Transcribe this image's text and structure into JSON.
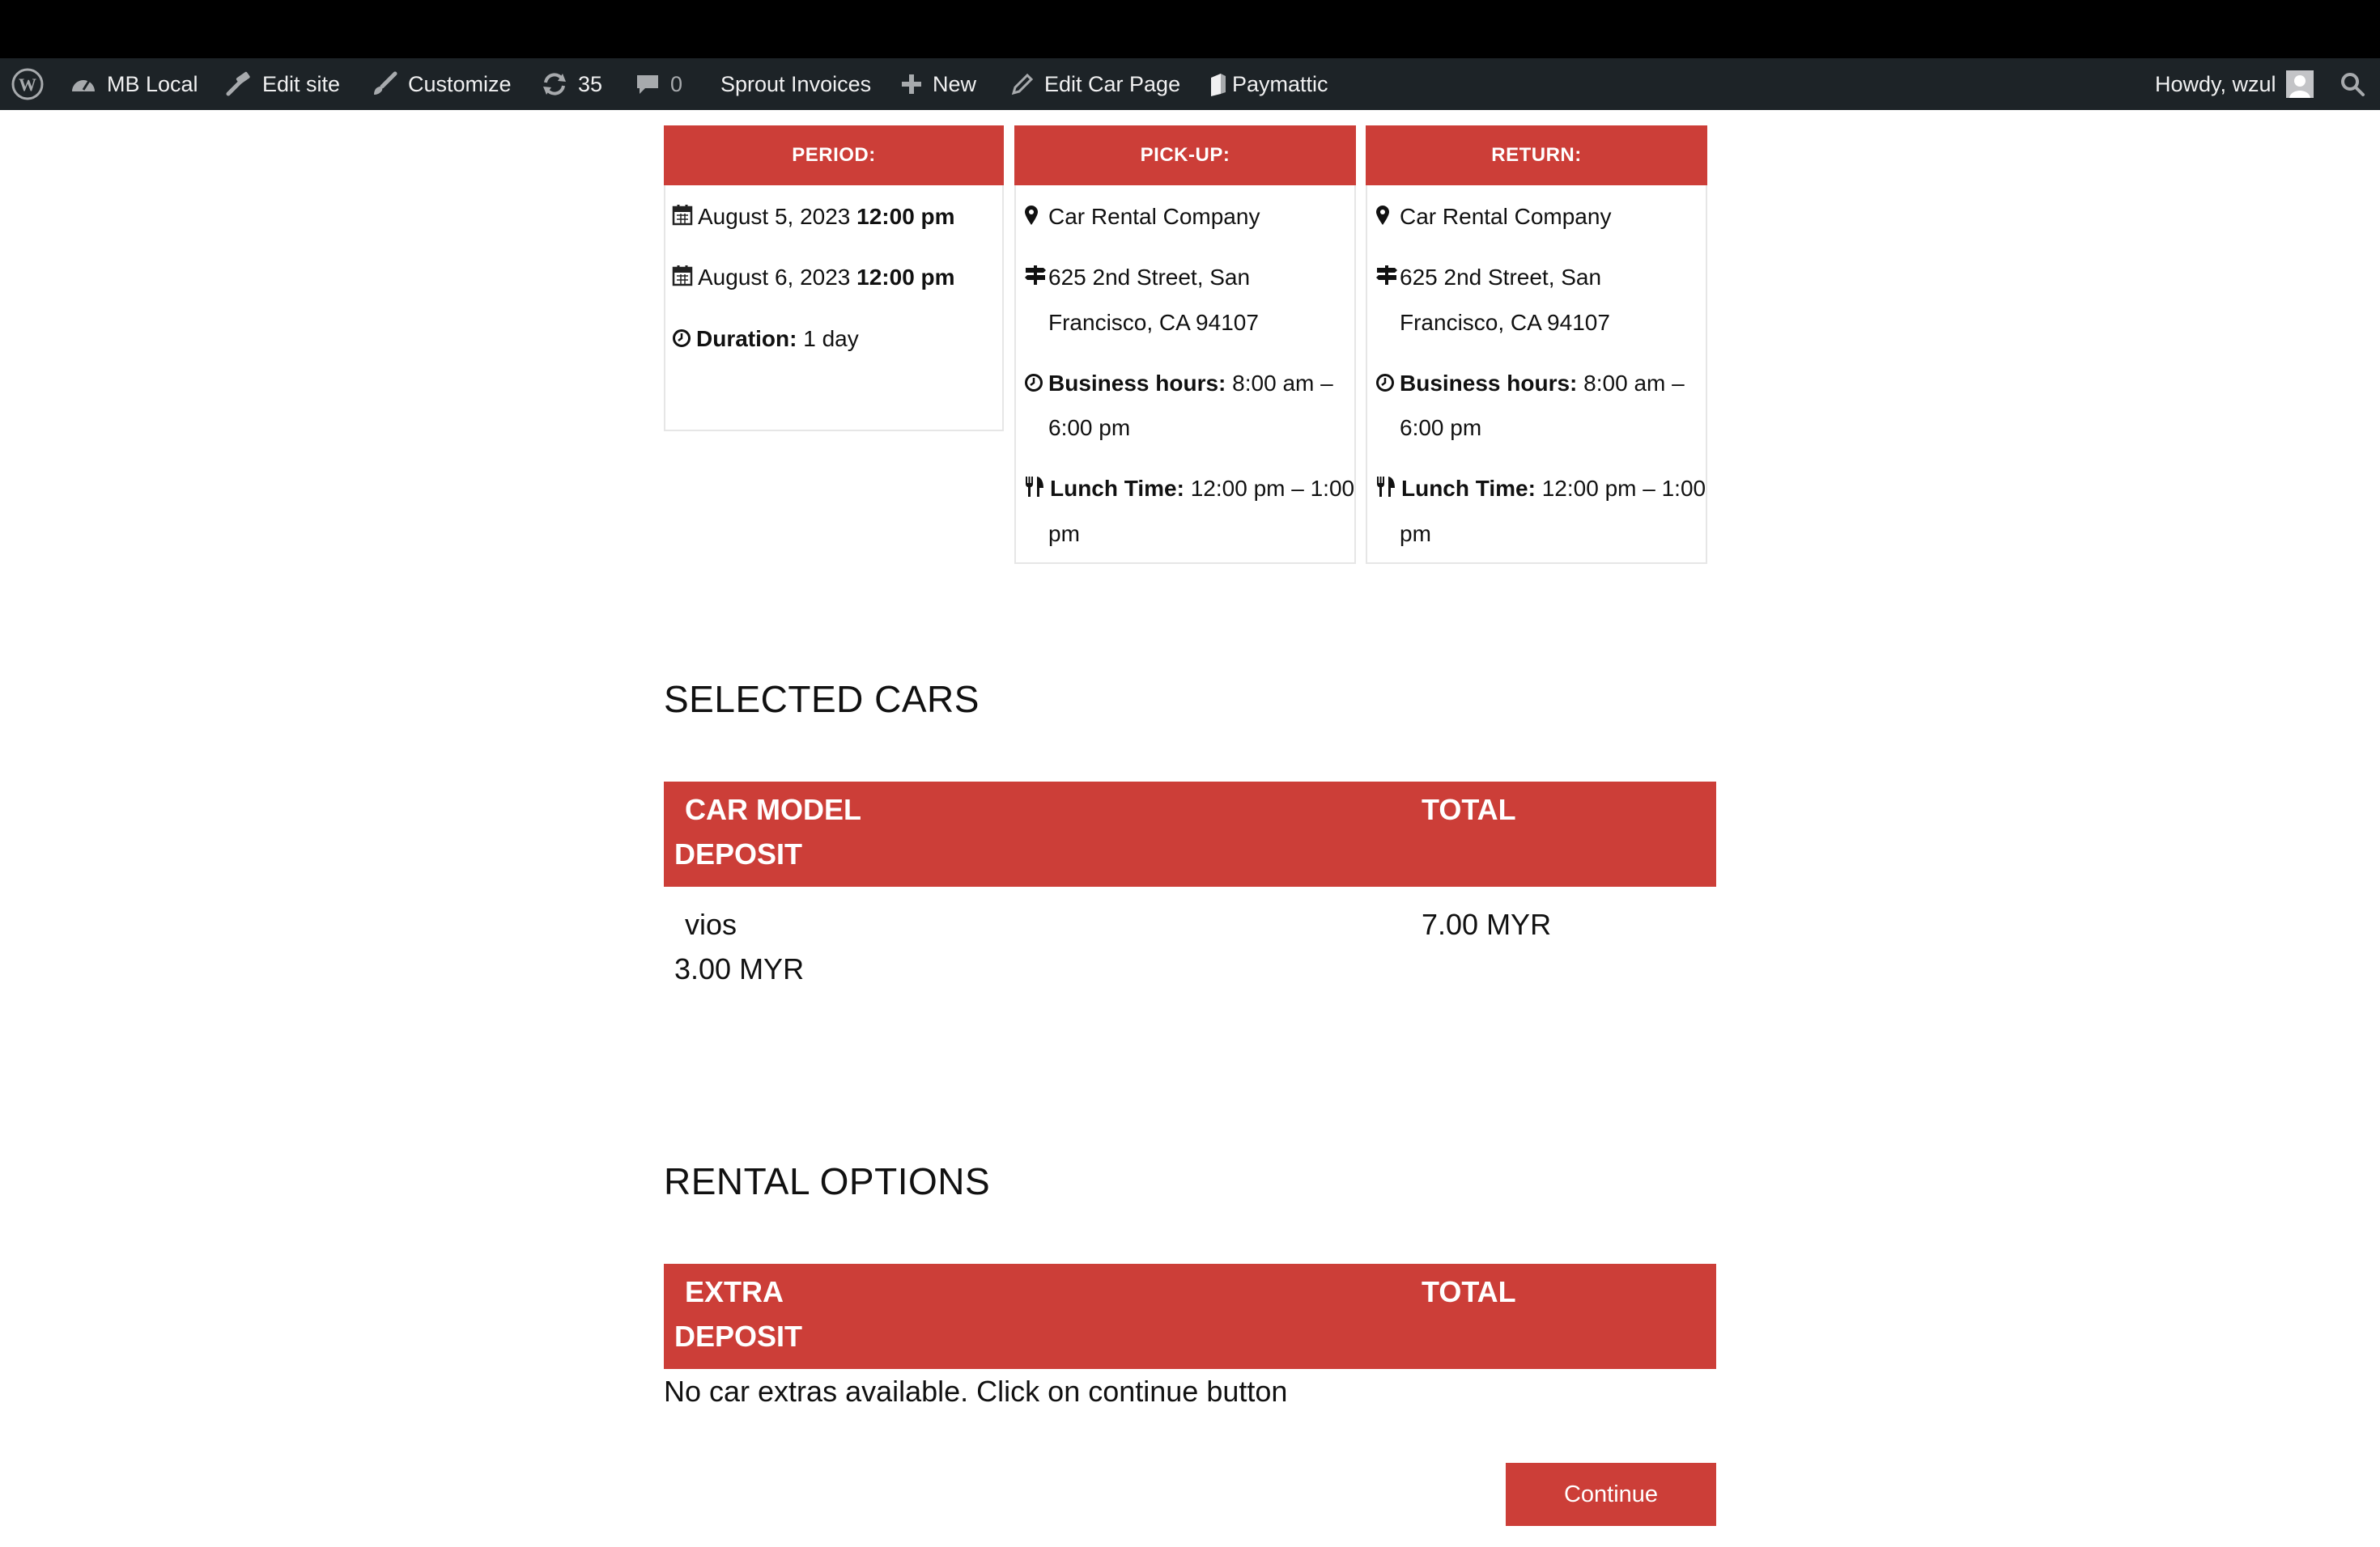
{
  "admin_bar": {
    "site_name": "MB Local",
    "edit_site": "Edit site",
    "customize": "Customize",
    "updates_count": "35",
    "comments_count": "0",
    "sprout_invoices": "Sprout Invoices",
    "new": "New",
    "edit_car_page": "Edit Car Page",
    "paymattic": "Paymattic",
    "howdy": "Howdy, wzul"
  },
  "summary": {
    "period": {
      "header": "PERIOD:",
      "start_date": "August 5, 2023",
      "start_time": "12:00 pm",
      "end_date": "August 6, 2023",
      "end_time": "12:00 pm",
      "duration_label": "Duration:",
      "duration_value": "1 day"
    },
    "pickup": {
      "header": "PICK-UP:",
      "company": "Car Rental Company",
      "address_line1": "625 2nd Street, San",
      "address_line2": "Francisco, CA 94107",
      "hours_label": "Business hours:",
      "hours_line1": "8:00 am –",
      "hours_line2": "6:00 pm",
      "lunch_label": "Lunch Time:",
      "lunch_line1": "12:00 pm – 1:00",
      "lunch_line2": "pm"
    },
    "return": {
      "header": "RETURN:",
      "company": "Car Rental Company",
      "address_line1": "625 2nd Street, San",
      "address_line2": "Francisco, CA 94107",
      "hours_label": "Business hours:",
      "hours_line1": "8:00 am –",
      "hours_line2": "6:00 pm",
      "lunch_label": "Lunch Time:",
      "lunch_line1": "12:00 pm – 1:00",
      "lunch_line2": "pm"
    }
  },
  "selected_cars": {
    "title": "SELECTED CARS",
    "headers": {
      "model": "CAR MODEL",
      "total": "TOTAL",
      "deposit": "DEPOSIT"
    },
    "rows": [
      {
        "model": "vios",
        "total": "7.00 MYR",
        "deposit": "3.00 MYR"
      }
    ]
  },
  "rental_options": {
    "title": "RENTAL OPTIONS",
    "headers": {
      "extra": "EXTRA",
      "total": "TOTAL",
      "deposit": "DEPOSIT"
    },
    "empty_message": "No car extras available. Click on continue button"
  },
  "continue_button": "Continue",
  "colors": {
    "accent": "#cc3e38",
    "admin_bar": "#1d2327"
  }
}
